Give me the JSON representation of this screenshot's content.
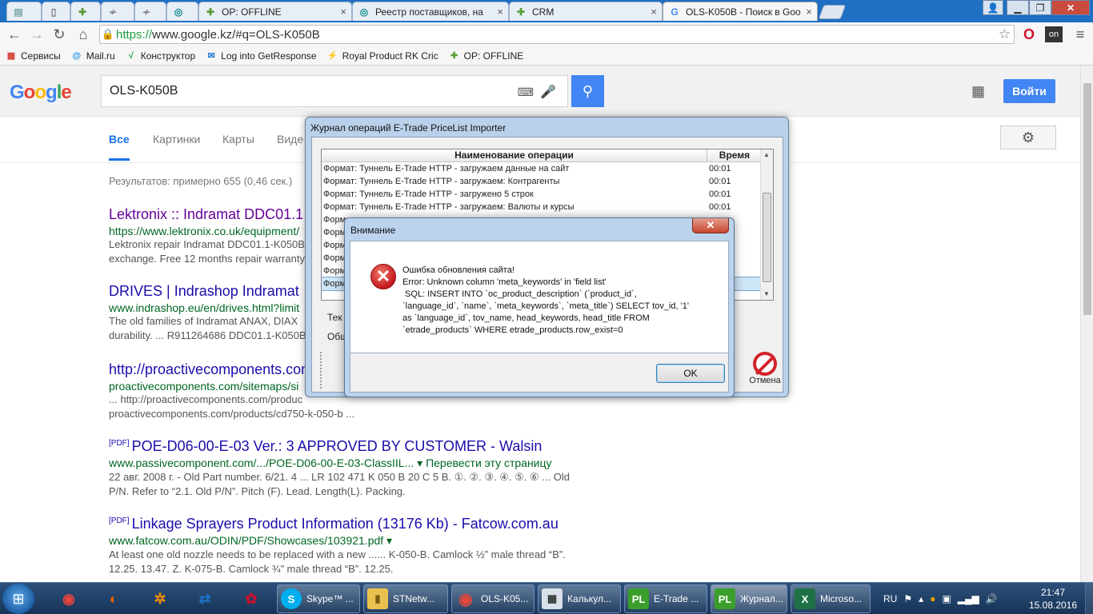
{
  "browser": {
    "tabs": [
      {
        "title": "",
        "icon": "page-icon",
        "color": "#777"
      },
      {
        "title": "",
        "icon": "puzzle-icon",
        "color": "#5a9e3a"
      },
      {
        "title": "",
        "icon": "mute-icon",
        "color": "#777"
      },
      {
        "title": "",
        "icon": "mute-icon",
        "color": "#777"
      },
      {
        "title": "",
        "icon": "ring-icon",
        "color": "#0a8a8a"
      },
      {
        "title": "OP: OFFLINE",
        "icon": "puzzle-icon",
        "color": "#5a9e3a"
      },
      {
        "title": "Реестр поставщиков, на",
        "icon": "ring-icon",
        "color": "#0a8a8a"
      },
      {
        "title": "CRM",
        "icon": "puzzle-icon",
        "color": "#5a9e3a"
      },
      {
        "title": "OLS-K050B - Поиск в Goo",
        "icon": "google-icon",
        "color": "#4285f4"
      }
    ],
    "url_https": "https://",
    "url_rest": "www.google.kz/#q=OLS-K050B",
    "bookmarks": [
      {
        "label": "Сервисы",
        "icon": "apps-icon",
        "color": "#d23f31"
      },
      {
        "label": "Mail.ru",
        "icon": "mailru-icon",
        "color": "#168de2"
      },
      {
        "label": "Конструктор",
        "icon": "chart-icon",
        "color": "#1a9e3f"
      },
      {
        "label": "Log into GetResponse",
        "icon": "envelope-icon",
        "color": "#1f7ad6"
      },
      {
        "label": "Royal Product RK Cric",
        "icon": "bolt-icon",
        "color": "#c0392b"
      },
      {
        "label": "OP: OFFLINE",
        "icon": "puzzle-icon",
        "color": "#5a9e3a"
      }
    ]
  },
  "google": {
    "query": "OLS-K050B",
    "signin": "Войти",
    "tabs": [
      "Все",
      "Картинки",
      "Карты",
      "Виде"
    ],
    "stats": "Результатов: примерно 655 (0,46 сек.)",
    "results": [
      {
        "pdf": "",
        "title": "Lektronix :: Indramat DDC01.1",
        "url": "https://www.lektronix.co.uk/equipment/",
        "translate": "",
        "snippet1": "Lektronix repair Indramat DDC01.1-K050B",
        "snippet2": "exchange. Free 12 months repair warranty"
      },
      {
        "pdf": "",
        "title": "DRIVES | Indrashop Indramat",
        "url": "www.indrashop.eu/en/drives.html?limit",
        "translate": "",
        "snippet1": "The old families of Indramat ANAX, DIAX",
        "snippet2": "durability. ... R911264686 DDC01.1-K050B"
      },
      {
        "pdf": "",
        "title": "http://proactivecomponents.com",
        "url": "proactivecomponents.com/sitemaps/si",
        "translate": "",
        "snippet1": "... http://proactivecomponents.com/produc",
        "snippet2": "proactivecomponents.com/products/cd750-k-050-b ..."
      },
      {
        "pdf": "[PDF]",
        "title": "POE-D06-00-E-03 Ver.: 3 APPROVED BY CUSTOMER - Walsin",
        "url": "www.passivecomponent.com/.../POE-D06-00-E-03-ClassIIL... ▾",
        "translate": "Перевести эту страницу",
        "snippet1": "22 авг. 2008 г. - Old Part number. 6/21. 4 ... LR 102 471 K 050 B 20 C 5 B. ①. ②. ③. ④. ⑤. ⑥ ... Old",
        "snippet2": "P/N. Refer to “2.1. Old P/N”. Pitch (F). Lead. Length(L). Packing."
      },
      {
        "pdf": "[PDF]",
        "title": "Linkage Sprayers Product Information (13176 Kb) - Fatcow.com.au",
        "url": "www.fatcow.com.au/ODIN/PDF/Showcases/103921.pdf ▾",
        "translate": "",
        "snippet1": "At least one old nozzle needs to be replaced with a new ...... K-050-B. Camlock ½” male thread “B”.",
        "snippet2": "12.25. 13.47. Z. K-075-B. Camlock ¾” male thread “B”. 12.25."
      }
    ]
  },
  "journal": {
    "title": "Журнал операций E-Trade PriceList Importer",
    "col_name": "Наименование операции",
    "col_time": "Время",
    "rows": [
      {
        "name": "Формат: Туннель E-Trade HTTP - загружаем данные на сайт",
        "time": "00:01"
      },
      {
        "name": "Формат: Туннель E-Trade HTTP - загружаем: Контрагенты",
        "time": "00:01"
      },
      {
        "name": "Формат: Туннель E-Trade HTTP - загружено 5 строк",
        "time": "00:01"
      },
      {
        "name": "Формат: Туннель E-Trade HTTP - загружаем: Валюты и курсы",
        "time": "00:01"
      },
      {
        "name": "Форм",
        "time": ""
      },
      {
        "name": "Форм",
        "time": ""
      },
      {
        "name": "Форм",
        "time": ""
      },
      {
        "name": "Форм",
        "time": ""
      },
      {
        "name": "Форм",
        "time": ""
      },
      {
        "name": "Форм",
        "time": ""
      }
    ],
    "label_1": "Тек",
    "label_2": "Общ",
    "cancel": "Отмена"
  },
  "warning": {
    "title": "Внимание",
    "lines": [
      "Ошибка обновления сайта!",
      "Error: Unknown column 'meta_keywords' in 'field list'",
      " SQL: INSERT INTO `oc_product_description` (`product_id`,",
      "`language_id`, `name`, `meta_keywords`, `meta_title`) SELECT tov_id, '1'",
      "as `language_id`, tov_name, head_keywords, head_title FROM",
      "`etrade_products` WHERE etrade_products.row_exist=0"
    ],
    "ok": "OK"
  },
  "taskbar": {
    "pinned": [
      {
        "icon": "chrome-icon",
        "color": "#e8453c"
      },
      {
        "icon": "firefox-icon",
        "color": "#e66000"
      },
      {
        "icon": "lifebuoy-icon",
        "color": "#f08c00"
      },
      {
        "icon": "teamviewer-icon",
        "color": "#1d72c8"
      },
      {
        "icon": "huawei-icon",
        "color": "#c8102e"
      }
    ],
    "items": [
      {
        "label": "Skype™ ...",
        "icon": "skype-icon",
        "color": "#00aff0"
      },
      {
        "label": "STNetw...",
        "icon": "folder-icon",
        "color": "#e9c14f"
      },
      {
        "label": "OLS-K05...",
        "icon": "chrome-icon",
        "color": "#e8453c"
      },
      {
        "label": "Калькул...",
        "icon": "calculator-icon",
        "color": "#8aa0b8"
      },
      {
        "label": "E-Trade ...",
        "icon": "pli-icon",
        "color": "#3a9e2a"
      },
      {
        "label": "Журнал...",
        "icon": "pli-icon",
        "color": "#3a9e2a"
      },
      {
        "label": "Microso...",
        "icon": "excel-icon",
        "color": "#1e7145"
      }
    ],
    "lang": "RU",
    "time": "21:47",
    "date": "15.08.2016"
  }
}
